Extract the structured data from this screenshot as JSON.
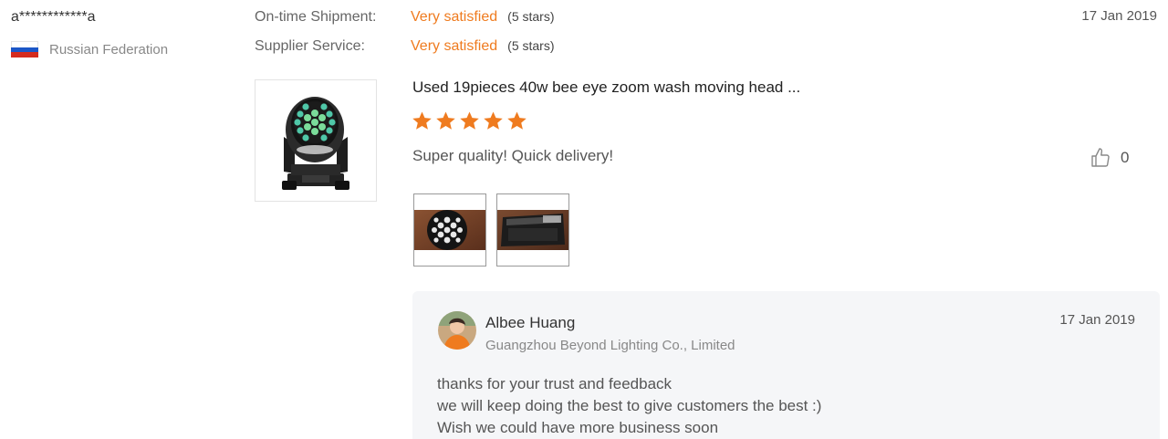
{
  "reviewer": {
    "name": "a************a",
    "country": "Russian Federation",
    "flag_icon": "russia-flag-icon"
  },
  "ratings": [
    {
      "label": "On-time Shipment:",
      "value": "Very satisfied",
      "stars_text": "(5 stars)"
    },
    {
      "label": "Supplier Service:",
      "value": "Very satisfied",
      "stars_text": "(5 stars)"
    }
  ],
  "review": {
    "date": "17 Jan 2019",
    "product_title": "Used 19pieces 40w bee eye zoom wash moving head ...",
    "rating": 5,
    "rating_max": 5,
    "comment": "Super quality! Quick delivery!",
    "likes": "0",
    "photos": [
      "led-beam-closeup-photo",
      "fixture-in-case-photo"
    ]
  },
  "reply": {
    "name": "Albee Huang",
    "company": "Guangzhou Beyond Lighting Co., Limited",
    "date": "17 Jan 2019",
    "lines": [
      "thanks for your trust and feedback",
      "we will keep doing the best to give customers the best :)",
      "Wish we could have more business soon"
    ]
  },
  "colors": {
    "accent": "#ef7b1f",
    "reply_bg": "#f5f6f8",
    "muted_text": "#888888"
  }
}
